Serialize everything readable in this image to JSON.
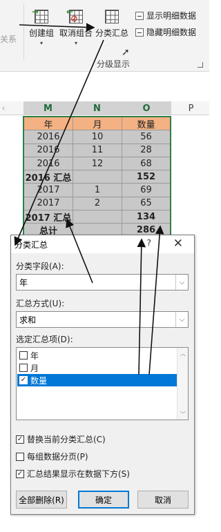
{
  "ribbon": {
    "partial_left_label": "关系",
    "create_group": "创建组",
    "ungroup": "取消组合",
    "subtotal": "分类汇总",
    "show_detail": "显示明细数据",
    "hide_detail": "隐藏明细数据",
    "group_label": "分级显示"
  },
  "sheet": {
    "columns": [
      "M",
      "N",
      "O",
      "P"
    ],
    "table": {
      "header": [
        "年",
        "月",
        "数量"
      ],
      "rows": [
        {
          "kind": "body",
          "cells": [
            "2016",
            "10",
            "56"
          ]
        },
        {
          "kind": "body",
          "cells": [
            "2016",
            "11",
            "28"
          ]
        },
        {
          "kind": "body",
          "cells": [
            "2016",
            "12",
            "68"
          ]
        },
        {
          "kind": "sub",
          "cells": [
            "2016 汇总",
            "",
            "152"
          ]
        },
        {
          "kind": "body",
          "cells": [
            "2017",
            "1",
            "69"
          ]
        },
        {
          "kind": "body",
          "cells": [
            "2017",
            "2",
            "65"
          ]
        },
        {
          "kind": "sub",
          "cells": [
            "2017 汇总",
            "",
            "134"
          ]
        },
        {
          "kind": "sub",
          "cells": [
            "总计",
            "",
            "286"
          ]
        }
      ]
    }
  },
  "dialog": {
    "title": "分类汇总",
    "help": "?",
    "close": "✕",
    "field_label": "分类字段(A):",
    "field_value": "年",
    "func_label": "汇总方式(U):",
    "func_value": "求和",
    "items_label": "选定汇总项(D):",
    "items": [
      {
        "label": "年",
        "checked": false,
        "selected": false
      },
      {
        "label": "月",
        "checked": false,
        "selected": false
      },
      {
        "label": "数量",
        "checked": true,
        "selected": true
      }
    ],
    "options": [
      {
        "label": "替换当前分类汇总(C)",
        "checked": true
      },
      {
        "label": "每组数据分页(P)",
        "checked": false
      },
      {
        "label": "汇总结果显示在数据下方(S)",
        "checked": true
      }
    ],
    "btn_remove_all": "全部删除(R)",
    "btn_ok": "确定",
    "btn_cancel": "取消"
  },
  "colors": {
    "header_fill": "#f4b183",
    "body_fill": "#c8c8c8",
    "selection_blue": "#0078d7",
    "border_green": "#2f7d46"
  }
}
